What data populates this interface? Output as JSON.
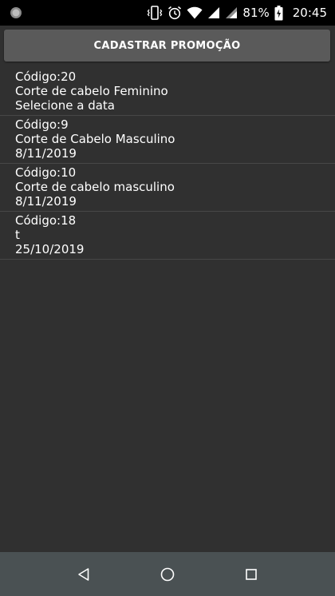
{
  "status_bar": {
    "battery_percent": "81%",
    "time": "20:45",
    "icons": [
      "camera-dot-icon",
      "vibrate-icon",
      "alarm-clock-icon",
      "wifi-icon",
      "cell-signal-icon",
      "cell-signal-icon",
      "battery-charging-icon"
    ]
  },
  "toolbar": {
    "cadastrar_label": "CADASTRAR PROMOÇÃO"
  },
  "promotions": [
    {
      "codigo": "Código:20",
      "descricao": "Corte de cabelo Feminino",
      "data": "Selecione a data"
    },
    {
      "codigo": "Código:9",
      "descricao": "Corte de Cabelo Masculino",
      "data": "8/11/2019"
    },
    {
      "codigo": "Código:10",
      "descricao": "Corte de cabelo masculino",
      "data": "8/11/2019"
    },
    {
      "codigo": "Código:18",
      "descricao": "t",
      "data": "25/10/2019"
    }
  ],
  "nav_bar": {
    "buttons": [
      "back-icon",
      "home-icon",
      "recents-icon"
    ]
  },
  "colors": {
    "background": "#303030",
    "button": "#5a5a5a",
    "nav_bar": "#4a5153",
    "status_bar": "#000000",
    "text": "#ffffff"
  }
}
